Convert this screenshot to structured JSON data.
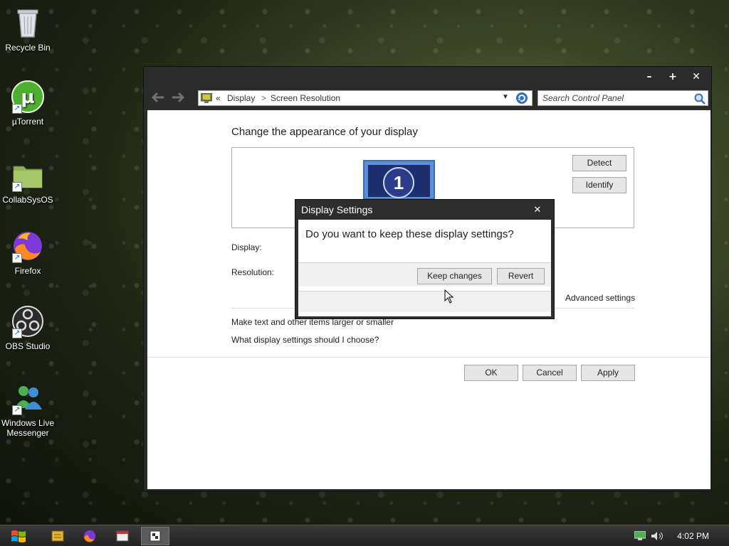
{
  "desktop": {
    "icons": [
      {
        "label": "Recycle Bin"
      },
      {
        "label": "µTorrent"
      },
      {
        "label": "CollabSysOS"
      },
      {
        "label": "Firefox"
      },
      {
        "label": "OBS Studio"
      },
      {
        "label": "Windows Live Messenger"
      }
    ]
  },
  "window": {
    "controls": {
      "minimize": "–",
      "maximize": "+",
      "close": "✕"
    },
    "breadcrumb": {
      "chevron": "«",
      "part1": "Display",
      "sep": ">",
      "part2": "Screen Resolution"
    },
    "search": {
      "placeholder": "Search Control Panel"
    },
    "heading": "Change the appearance of your display",
    "monitor_number": "1",
    "buttons": {
      "detect": "Detect",
      "identify": "Identify",
      "ok": "OK",
      "cancel": "Cancel",
      "apply": "Apply"
    },
    "labels": {
      "display": "Display:",
      "resolution": "Resolution:"
    },
    "links": {
      "advanced": "Advanced settings",
      "text_size": "Make text and other items larger or smaller",
      "choose": "What display settings should I choose?"
    }
  },
  "dialog": {
    "title": "Display Settings",
    "close": "✕",
    "message": "Do you want to keep these display settings?",
    "keep_label": "Keep changes",
    "revert_label": "Revert"
  },
  "taskbar": {
    "clock": "4:02 PM"
  },
  "colors": {
    "accent": "#1e63b8",
    "window_chrome": "#2b2b2b",
    "taskbar": "#2a2a2a"
  }
}
